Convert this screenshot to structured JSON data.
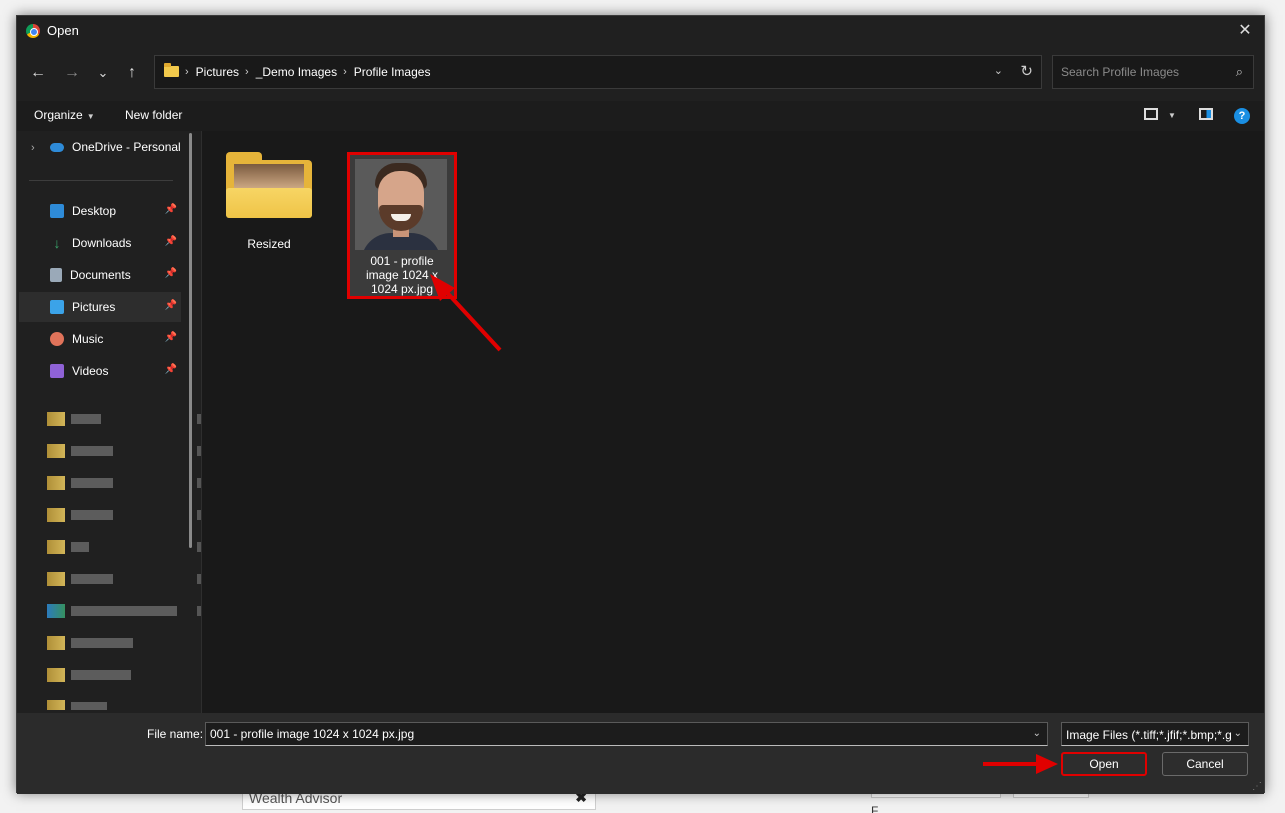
{
  "background_page": {
    "input_value": "Wealth Advisor",
    "clear_glyph": "✖",
    "snippet": "F"
  },
  "dialog": {
    "title": "Open",
    "close_glyph": "✕"
  },
  "nav": {
    "back_glyph": "←",
    "forward_glyph": "→",
    "recent_glyph": "⌄",
    "up_glyph": "↑",
    "breadcrumbs": [
      "Pictures",
      "_Demo Images",
      "Profile Images"
    ],
    "breadcrumb_sep": "›",
    "dropdown_glyph": "⌄",
    "refresh_glyph": "↻",
    "search_placeholder": "Search Profile Images",
    "search_glyph": "⌕"
  },
  "toolbar": {
    "organize_label": "Organize",
    "caret": "▼",
    "new_folder_label": "New folder",
    "help_glyph": "?"
  },
  "sidebar": {
    "expand_glyph": "›",
    "onedrive_label": "OneDrive - Personal",
    "pin_glyph": "📌",
    "items": [
      {
        "label": "Desktop",
        "color": "#2e8bd8"
      },
      {
        "label": "Downloads",
        "color": "#3aa56b"
      },
      {
        "label": "Documents",
        "color": "#9aa9b8"
      },
      {
        "label": "Pictures",
        "color": "#3ba3e8"
      },
      {
        "label": "Music",
        "color": "#e0735a"
      },
      {
        "label": "Videos",
        "color": "#8f62d6"
      }
    ]
  },
  "files": [
    {
      "name": "Resized",
      "type": "folder"
    },
    {
      "name": "001 - profile image 1024 x 1024 px.jpg",
      "caption_lines": [
        "001 - profile",
        "image 1024 x",
        "1024 px.jpg"
      ],
      "type": "image",
      "selected": true
    }
  ],
  "footer": {
    "file_name_label": "File name:",
    "file_name_value": "001 - profile image 1024 x 1024 px.jpg",
    "file_type_value": "Image Files (*.tiff;*.jfif;*.bmp;*.gif;*.svg;*.png;*.ico;*.webp;*.jpg;*.jpeg)",
    "dropdown_glyph": "⌄",
    "open_label": "Open",
    "cancel_label": "Cancel",
    "grip_glyph": "⋰"
  },
  "annotation_color": "#e00000"
}
